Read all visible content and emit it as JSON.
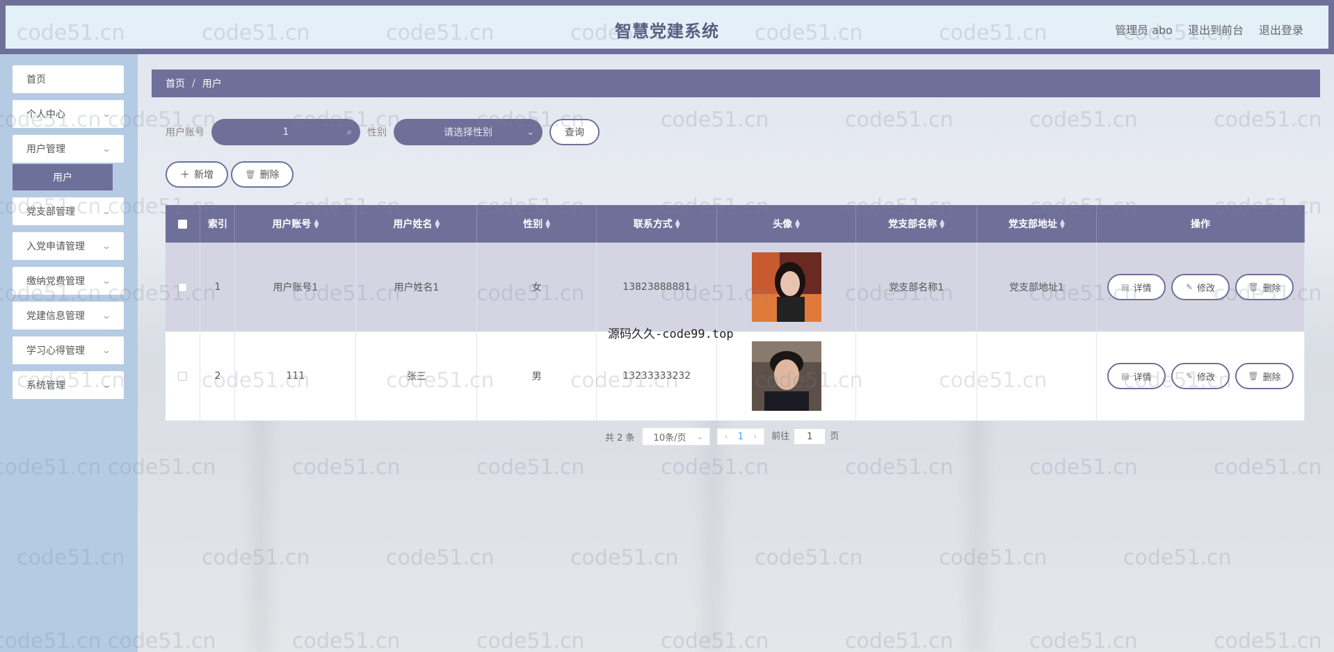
{
  "header": {
    "title": "智慧党建系统",
    "admin_label": "管理员 abo",
    "back_label": "退出到前台",
    "logout_label": "退出登录"
  },
  "sidebar": {
    "items": [
      {
        "label": "首页"
      },
      {
        "label": "个人中心"
      },
      {
        "label": "用户管理"
      },
      {
        "label": "党支部管理"
      },
      {
        "label": "入党申请管理"
      },
      {
        "label": "缴纳党费管理"
      },
      {
        "label": "党建信息管理"
      },
      {
        "label": "学习心得管理"
      },
      {
        "label": "系统管理"
      }
    ],
    "active_sub": "用户"
  },
  "breadcrumb": {
    "home": "首页",
    "sep": "/",
    "current": "用户"
  },
  "search": {
    "user_label": "用户账号",
    "user_value": "1",
    "sex_label": "性别",
    "sex_placeholder": "请选择性别",
    "query_label": "查询"
  },
  "actions": {
    "add_label": "新增",
    "delete_label": "删除"
  },
  "table": {
    "headers": [
      "索引",
      "用户账号",
      "用户姓名",
      "性别",
      "联系方式",
      "头像",
      "党支部名称",
      "党支部地址",
      "操作"
    ],
    "rows": [
      {
        "index": "1",
        "account": "用户账号1",
        "name": "用户姓名1",
        "sex": "女",
        "phone": "13823888881",
        "branch": "党支部名称1",
        "address": "党支部地址1"
      },
      {
        "index": "2",
        "account": "111",
        "name": "张三",
        "sex": "男",
        "phone": "13233333232",
        "branch": "",
        "address": ""
      }
    ],
    "op_detail": "详情",
    "op_edit": "修改",
    "op_delete": "删除"
  },
  "pagination": {
    "total": "共 2 条",
    "page_size": "10条/页",
    "current": "1",
    "goto_label": "前往",
    "goto_value": "1",
    "page_suffix": "页"
  },
  "overlay_text": "源码久久-code99.top",
  "watermark": "code51.cn",
  "colors": {
    "primary": "#6f7099",
    "sidebar": "#b5cbe3",
    "header": "#e3f0f8"
  }
}
